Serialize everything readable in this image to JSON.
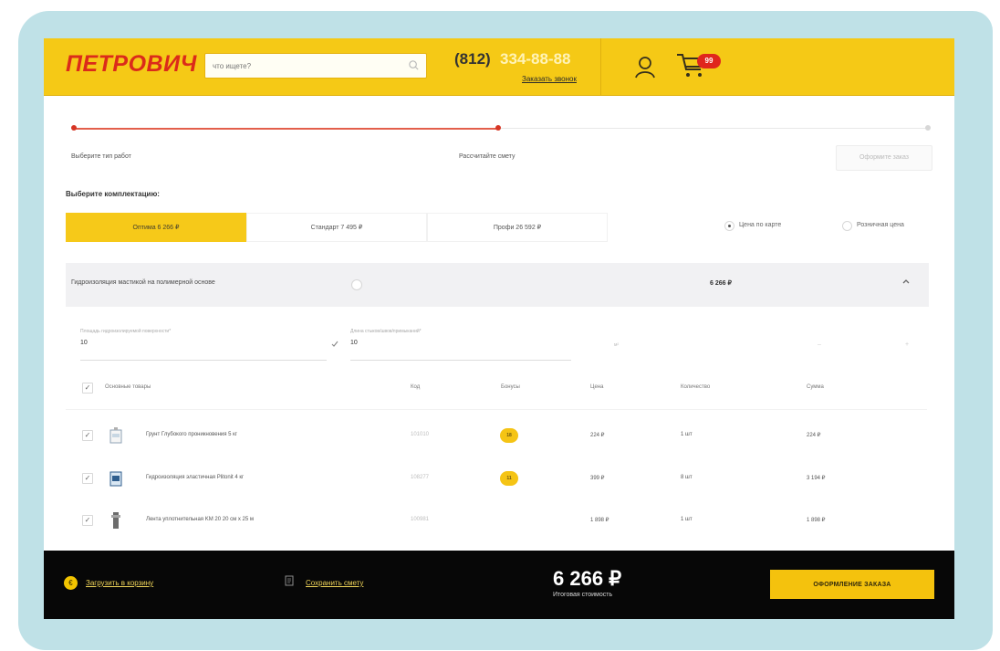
{
  "header": {
    "logo": "ПЕТРОВИЧ",
    "search_placeholder": "что ищете?",
    "phone_code": "(812)",
    "phone_number": "334-88-88",
    "callback_link": "Заказать звонок",
    "cart_count": "99"
  },
  "steps": {
    "items": [
      "Выберите тип работ",
      "Рассчитайте смету",
      "Оформите заказ"
    ]
  },
  "configuration": {
    "title": "Выберите комплектацию:",
    "tabs": [
      "Оптима 6 266 ₽",
      "Стандарт 7 495 ₽",
      "Профи 26 592 ₽"
    ],
    "price_options": [
      "Цена по карте",
      "Розничная цена"
    ],
    "selected_price_option": "Цена по карте"
  },
  "work": {
    "title": "Гидроизоляция мастикой на полимерной основе",
    "price": "6 266 ₽",
    "fields": [
      {
        "label": "Площадь гидроизолируемой поверхности*",
        "value": "10"
      },
      {
        "label": "Длина стыков/швов/примыканий*",
        "value": "10"
      }
    ],
    "unit_text": "м²"
  },
  "table": {
    "headers": [
      "Основные товары",
      "Код",
      "Бонусы",
      "Цена",
      "Количество",
      "Сумма"
    ],
    "rows": [
      {
        "icon": "primer-can-icon",
        "name": "Грунт Глубокого проникновения 5 кг",
        "code": "101010",
        "bonus": "18",
        "price": "224 ₽",
        "qty": "1 шт",
        "sum": "224 ₽"
      },
      {
        "icon": "waterproofing-bucket-icon",
        "name": "Гидроизоляция эластичная Plitonit 4 кг",
        "code": "108277",
        "bonus": "11",
        "price": "399 ₽",
        "qty": "8 шт",
        "sum": "3 194 ₽"
      },
      {
        "icon": "sealing-tape-icon",
        "name": "Лента уплотнительная KM 20 20 см х 25 м",
        "code": "100981",
        "bonus": "",
        "price": "1 898 ₽",
        "qty": "1 шт",
        "sum": "1 898 ₽"
      }
    ]
  },
  "footer": {
    "left_circle": "€",
    "left_link": "Загрузить в корзину",
    "save_link": "Сохранить смету",
    "total": "6 266 ₽",
    "total_caption": "Итоговая стоимость",
    "order_button": "ОФОРМЛЕНИЕ ЗАКАЗА"
  },
  "colors": {
    "bezel": "#bfe1e7",
    "brand_yellow": "#f5c916",
    "brand_red": "#db2b1a",
    "footer_black": "#070707"
  }
}
